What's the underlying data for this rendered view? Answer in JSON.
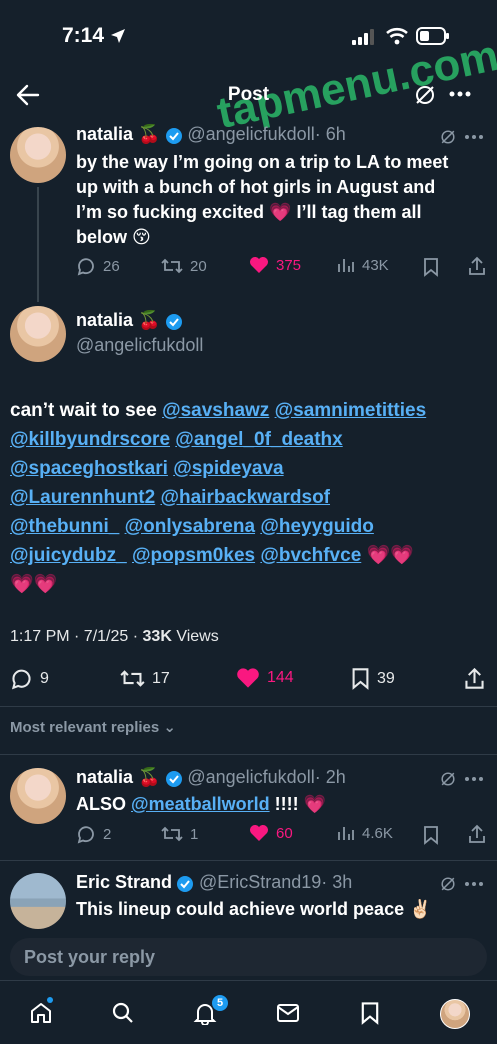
{
  "status_bar": {
    "time": "7:14"
  },
  "header": {
    "title": "Post"
  },
  "watermark": "tapmenu.com",
  "thread_post": {
    "name": "natalia 🍒",
    "handle": "@angelicfukdoll",
    "time": "· 6h",
    "lines": [
      "by the way I’m going on a trip to LA to meet",
      "up with a bunch of hot girls in August and",
      "I’m so fucking excited 💗 I’ll tag them all",
      "below 😚"
    ],
    "replies": "26",
    "reposts": "20",
    "likes": "375",
    "views": "43K"
  },
  "main_post": {
    "name": "natalia 🍒",
    "handle": "@angelicfukdoll",
    "intro": "can’t wait to see",
    "mentions": [
      "@savshawz",
      "@samnimetitties",
      "@killbyundrscore",
      "@angel_0f_deathx",
      "@spaceghostkari",
      "@spideyava",
      "@Laurennhunt2",
      "@hairbackwardsof",
      "@thebunni_",
      "@onlysabrena",
      "@heyyguido",
      "@juicydubz_",
      "@popsm0kes",
      "@bvchfvce"
    ],
    "hearts_line3": "💗💗",
    "hearts_line4": "💗💗",
    "timestamp": "1:17 PM · 7/1/25 · ",
    "views_count": "33K",
    "views_label": " Views",
    "replies": "9",
    "reposts": "17",
    "likes": "144",
    "bookmarks": "39"
  },
  "sort": {
    "label": "Most relevant replies"
  },
  "reply1": {
    "name": "natalia 🍒",
    "handle": "@angelicfukdoll",
    "time": "· 2h",
    "prefix": "ALSO ",
    "mention": "@meatballworld",
    "suffix": " !!!! 💗",
    "replies": "2",
    "reposts": "1",
    "likes": "60",
    "views": "4.6K"
  },
  "reply2": {
    "name": "Eric Strand",
    "handle": "@EricStrand19",
    "time": "· 3h",
    "text": "This lineup could achieve world peace ✌🏻"
  },
  "composer": {
    "placeholder": "Post your reply"
  },
  "tabbar": {
    "notifications_badge": "5"
  }
}
